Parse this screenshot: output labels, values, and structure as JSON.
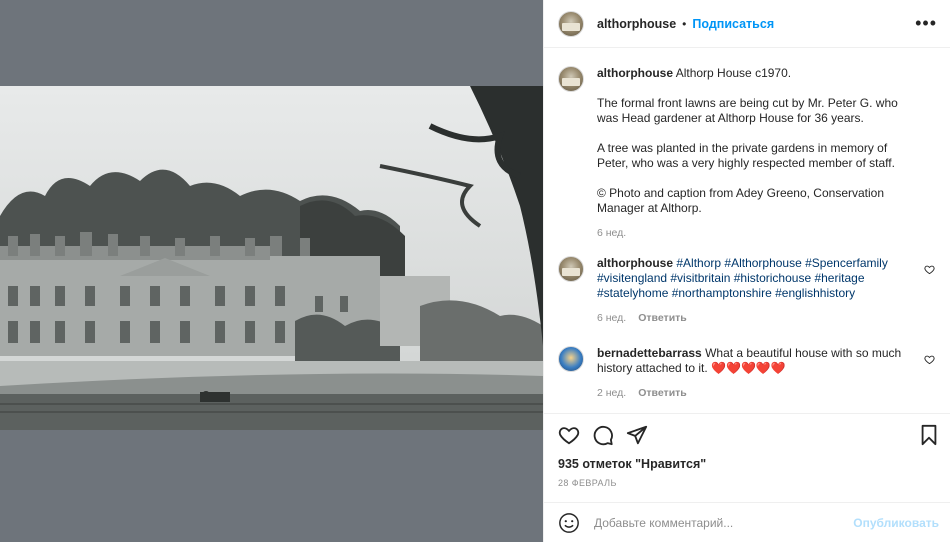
{
  "post": {
    "username": "althorphouse",
    "follow_label": "Подписаться",
    "more_label": "•••"
  },
  "caption": {
    "username": "althorphouse",
    "title": "Althorp House c1970.",
    "p1": "The formal front lawns are being cut by Mr. Peter G. who was Head gardener at Althorp House for 36 years.",
    "p2": "A tree was planted in the private gardens in memory of Peter, who was a very highly respected member of staff.",
    "p3": "© Photo and caption from Adey Greeno, Conservation Manager at Althorp.",
    "time": "6 нед."
  },
  "comments": [
    {
      "username": "althorphouse",
      "text": "#Althorp #Althorphouse #Spencerfamily #visitengland #visitbritain #historichouse #heritage #statelyhome #northamptonshire #englishhistory",
      "time": "6 нед.",
      "reply": "Ответить"
    },
    {
      "username": "bernadettebarrass",
      "text": "What a beautiful house with so much history attached to it. ❤️❤️❤️❤️❤️",
      "time": "2 нед.",
      "reply": "Ответить"
    }
  ],
  "stats": {
    "likes": "935 отметок \"Нравится\"",
    "date": "28 ФЕВРАЛЬ"
  },
  "composer": {
    "placeholder": "Добавьте комментарий...",
    "post_label": "Опубликовать"
  },
  "icons": {
    "like": "heart-icon",
    "comment": "comment-icon",
    "share": "share-icon",
    "save": "bookmark-icon",
    "emoji": "emoji-icon"
  }
}
